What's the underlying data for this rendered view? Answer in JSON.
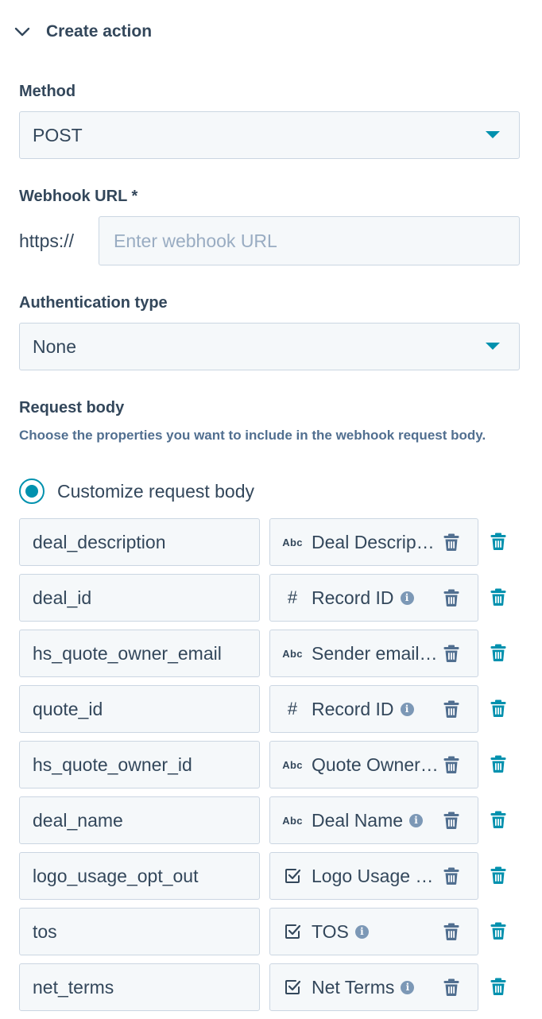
{
  "section": {
    "title": "Create action"
  },
  "method": {
    "label": "Method",
    "value": "POST"
  },
  "webhook": {
    "label": "Webhook URL *",
    "prefix": "https://",
    "placeholder": "Enter webhook URL"
  },
  "auth": {
    "label": "Authentication type",
    "value": "None"
  },
  "request_body": {
    "label": "Request body",
    "help": "Choose the properties you want to include in the webhook request body.",
    "radio_label": "Customize request body"
  },
  "rows": [
    {
      "key": "deal_description",
      "type": "text",
      "type_icon": "Abc",
      "prop": "Deal Descrip…",
      "info": false
    },
    {
      "key": "deal_id",
      "type": "number",
      "type_icon": "#",
      "prop": "Record ID",
      "info": true
    },
    {
      "key": "hs_quote_owner_email",
      "type": "text",
      "type_icon": "Abc",
      "prop": "Sender email…",
      "info": false
    },
    {
      "key": "quote_id",
      "type": "number",
      "type_icon": "#",
      "prop": "Record ID",
      "info": true
    },
    {
      "key": "hs_quote_owner_id",
      "type": "text",
      "type_icon": "Abc",
      "prop": "Quote Owner…",
      "info": false
    },
    {
      "key": "deal_name",
      "type": "text",
      "type_icon": "Abc",
      "prop": "Deal Name",
      "info": true
    },
    {
      "key": "logo_usage_opt_out",
      "type": "checkbox",
      "type_icon": "",
      "prop": "Logo Usage …",
      "info": false
    },
    {
      "key": "tos",
      "type": "checkbox",
      "type_icon": "",
      "prop": "TOS",
      "info": true
    },
    {
      "key": "net_terms",
      "type": "checkbox",
      "type_icon": "",
      "prop": "Net Terms",
      "info": true
    }
  ],
  "info_glyph": "i",
  "colors": {
    "accent": "#0091ae",
    "text": "#33475b",
    "input_bg": "#f5f8fa",
    "border": "#cbd6e2",
    "muted": "#516f90"
  }
}
